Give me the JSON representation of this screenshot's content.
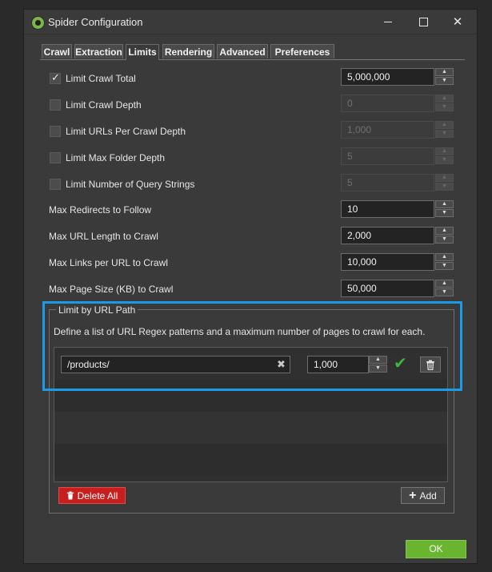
{
  "window": {
    "title": "Spider Configuration"
  },
  "tabs": [
    {
      "label": "Crawl",
      "active": false
    },
    {
      "label": "Extraction",
      "active": false
    },
    {
      "label": "Limits",
      "active": true
    },
    {
      "label": "Rendering",
      "active": false
    },
    {
      "label": "Advanced",
      "active": false
    },
    {
      "label": "Preferences",
      "active": false
    }
  ],
  "limits": {
    "checkbox_rows": [
      {
        "label": "Limit Crawl Total",
        "checked": true,
        "value": "5,000,000",
        "enabled": true
      },
      {
        "label": "Limit Crawl Depth",
        "checked": false,
        "value": "0",
        "enabled": false
      },
      {
        "label": "Limit URLs Per Crawl Depth",
        "checked": false,
        "value": "1,000",
        "enabled": false
      },
      {
        "label": "Limit Max Folder Depth",
        "checked": false,
        "value": "5",
        "enabled": false
      },
      {
        "label": "Limit Number of Query Strings",
        "checked": false,
        "value": "5",
        "enabled": false
      }
    ],
    "value_rows": [
      {
        "label": "Max Redirects to Follow",
        "value": "10"
      },
      {
        "label": "Max URL Length to Crawl",
        "value": "2,000"
      },
      {
        "label": "Max Links per URL to Crawl",
        "value": "10,000"
      },
      {
        "label": "Max Page Size (KB) to Crawl",
        "value": "50,000"
      }
    ]
  },
  "url_path": {
    "group_title": "Limit by URL Path",
    "description": "Define a list of URL Regex patterns and a maximum number of pages to crawl for each.",
    "entry": {
      "pattern": "/products/",
      "max_pages": "1,000"
    },
    "delete_all_label": "Delete All",
    "add_label": "Add"
  },
  "ok_label": "OK",
  "colors": {
    "highlight": "#1a9be8",
    "delete": "#c81e1e",
    "ok": "#6ab52f",
    "confirm_check": "#3fb43f"
  }
}
